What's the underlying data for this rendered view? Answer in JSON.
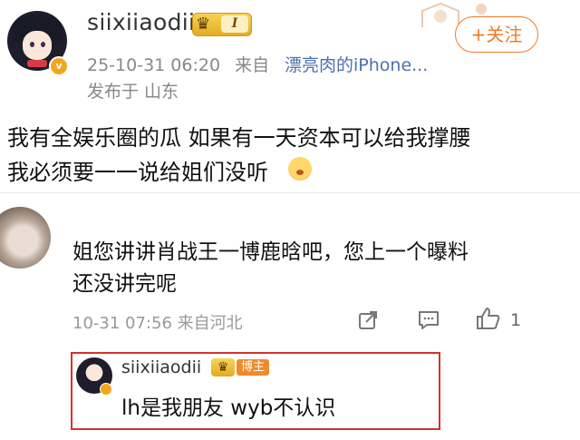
{
  "post": {
    "username": "siixiiaodii",
    "level_badge": "I",
    "follow_label": "+关注",
    "timestamp": "25-10-31 06:20",
    "source_prefix": "来自",
    "source_device": "漂亮肉的iPhone...",
    "location": "发布于 山东",
    "text_line1": "我有全娱乐圈的瓜 如果有一天资本可以给我撑腰",
    "text_line2": "我必须要一一说给姐们没听"
  },
  "comment": {
    "text_line1": "姐您讲讲肖战王一博鹿晗吧，您上一个曝料",
    "text_line2": "还没讲完呢",
    "meta": "10-31 07:56 来自河北",
    "like_count": "1"
  },
  "reply": {
    "username": "siixiiaodii",
    "blogger_tag": "博主",
    "text": "lh是我朋友 wyb不认识"
  },
  "icons": {
    "share": "share-icon",
    "comment": "comment-icon",
    "like": "thumbs-up-icon",
    "verified": "verified-v-icon",
    "crown": "crown-icon"
  },
  "colors": {
    "accent_orange": "#f07a2a",
    "link_blue": "#4a70b2",
    "highlight_red": "#d6322c"
  }
}
